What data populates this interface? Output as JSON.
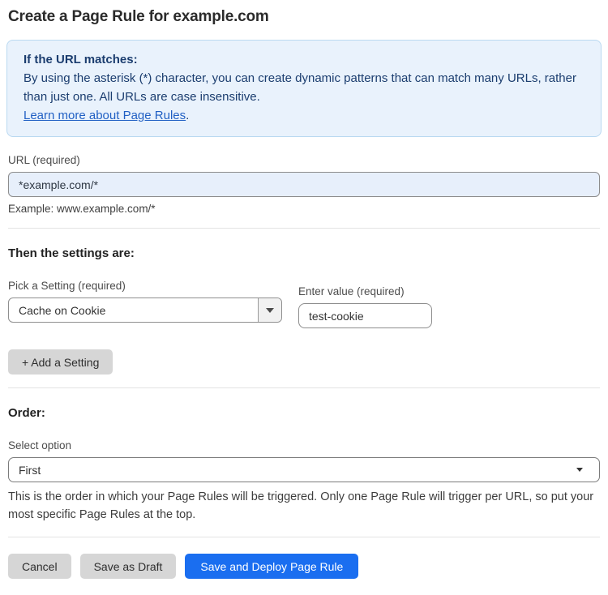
{
  "page": {
    "title": "Create a Page Rule for example.com"
  },
  "info_box": {
    "heading": "If the URL matches:",
    "body": "By using the asterisk (*) character, you can create dynamic patterns that can match many URLs, rather than just one. All URLs are case insensitive.",
    "link_label": "Learn more about Page Rules",
    "link_suffix": "."
  },
  "url_field": {
    "label": "URL (required)",
    "value": "*example.com/*",
    "example": "Example: www.example.com/*"
  },
  "settings": {
    "heading": "Then the settings are:",
    "setting_label": "Pick a Setting (required)",
    "setting_value": "Cache on Cookie",
    "value_label": "Enter value (required)",
    "value_value": "test-cookie",
    "add_button": "+ Add a Setting"
  },
  "order": {
    "heading": "Order:",
    "select_label": "Select option",
    "select_value": "First",
    "help_text": "This is the order in which your Page Rules will be triggered. Only one Page Rule will trigger per URL, so put your most specific Page Rules at the top."
  },
  "footer": {
    "cancel": "Cancel",
    "save_draft": "Save as Draft",
    "save_deploy": "Save and Deploy Page Rule"
  },
  "icons": {
    "setting_dropdown_arrow": "caret-down",
    "order_dropdown_arrow": "caret-down"
  },
  "colors": {
    "accent_blue": "#1A6EF0",
    "link_blue": "#2160C4",
    "info_bg": "#E9F2FC",
    "info_border": "#BAD9F1",
    "info_text": "#1B3D6F",
    "url_input_bg": "#E7EFFB",
    "button_gray": "#D6D6D6",
    "divider": "#E3E3E3"
  }
}
